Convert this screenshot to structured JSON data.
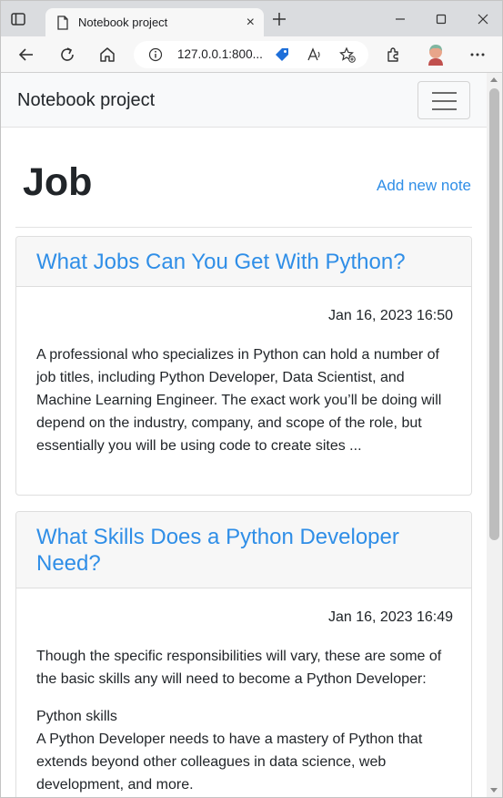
{
  "browser": {
    "tab_title": "Notebook project",
    "tab_close": "×",
    "url": "127.0.0.1:800..."
  },
  "navbar": {
    "brand": "Notebook project"
  },
  "page": {
    "heading": "Job",
    "add_note_label": "Add new note"
  },
  "notes": [
    {
      "title": "What Jobs Can You Get With Python?",
      "date": "Jan 16, 2023 16:50",
      "paragraphs": [
        "A professional who specializes in Python can hold a number of job titles, including Python Developer, Data Scientist, and Machine Learning Engineer. The exact work you’ll be doing will depend on the industry, company, and scope of the role, but essentially you will be using code to create sites ..."
      ]
    },
    {
      "title": "What Skills Does a Python Developer Need?",
      "date": "Jan 16, 2023 16:49",
      "paragraphs": [
        "Though the specific responsibilities will vary, these are some of the basic skills any will need to become a Python Developer:",
        "Python skills",
        "A Python Developer needs to have a mastery of Python that extends beyond other colleagues in data science, web development, and more."
      ]
    }
  ],
  "colors": {
    "link": "#2f8ee7",
    "navbar_bg": "#f8f9fa",
    "card_header_bg": "#f7f7f7"
  },
  "icons": {
    "tab_actions": "tab-actions-icon",
    "favicon": "page-icon",
    "new_tab": "plus-icon",
    "minimize": "minimize-icon",
    "maximize": "maximize-icon",
    "close": "close-icon",
    "back": "back-arrow-icon",
    "refresh": "refresh-icon",
    "home": "home-icon",
    "info": "info-icon",
    "tag": "tag-icon",
    "read_aloud": "read-aloud-icon",
    "favorites": "add-favorite-icon",
    "extensions": "extensions-icon",
    "profile": "profile-avatar",
    "menu": "more-icon",
    "hamburger": "hamburger-icon"
  }
}
